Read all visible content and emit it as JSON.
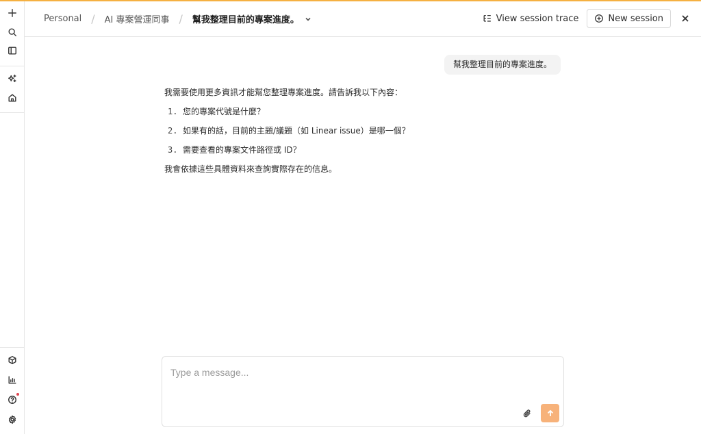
{
  "theme": {
    "accent": "#f5b041",
    "send_button": "#f7b27a",
    "notification_dot": "#e0444f"
  },
  "rail": {
    "top_icons": [
      "plus-icon",
      "search-icon",
      "sidebar-toggle-icon",
      "sparkles-icon",
      "home-icon"
    ],
    "bottom_icons": [
      "cube-icon",
      "bar-chart-icon",
      "help-icon",
      "gear-icon"
    ]
  },
  "header": {
    "breadcrumbs": [
      "Personal",
      "AI 專案營運同事",
      "幫我整理目前的專案進度。"
    ],
    "view_trace_label": "View session trace",
    "new_session_label": "New session"
  },
  "chat": {
    "user_message": "幫我整理目前的專案進度。",
    "assistant": {
      "intro": "我需要使用更多資訊才能幫您整理專案進度。請告訴我以下內容：",
      "items": [
        {
          "num": "1.",
          "text": "您的專案代號是什麼？"
        },
        {
          "num": "2.",
          "text": "如果有的話，目前的主題/議題（如 Linear issue）是哪一個？"
        },
        {
          "num": "3.",
          "text": "需要查看的專案文件路徑或 ID？"
        }
      ],
      "outro": "我會依據這些具體資料來查詢實際存在的信息。"
    }
  },
  "composer": {
    "placeholder": "Type a message..."
  }
}
